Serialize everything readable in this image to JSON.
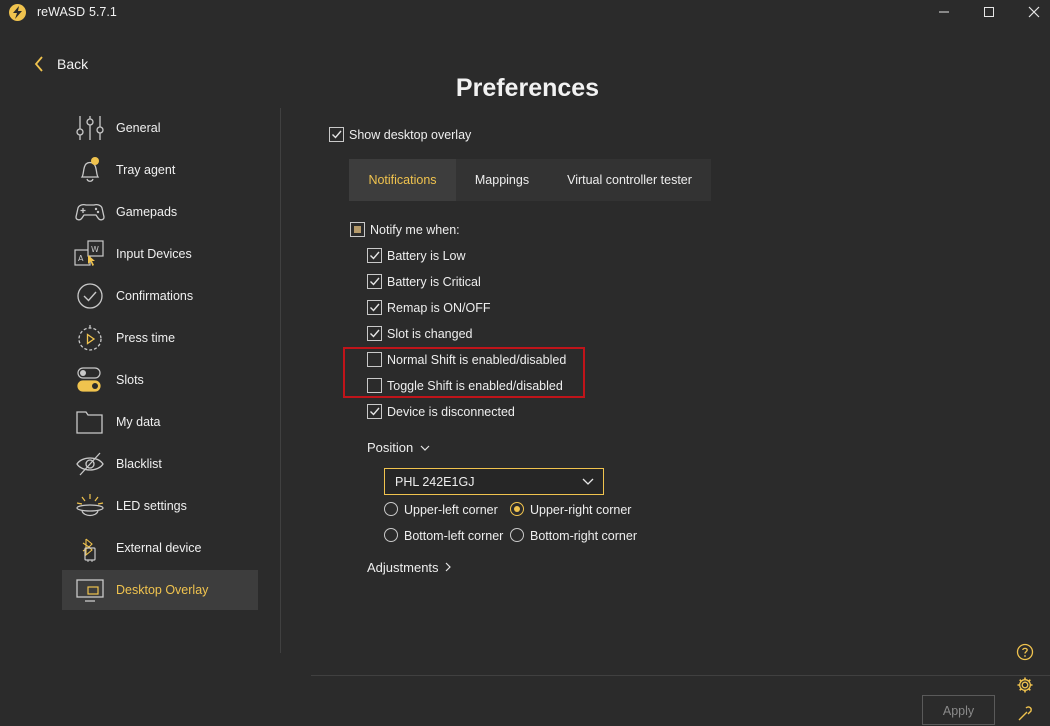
{
  "window": {
    "app_name": "reWASD",
    "version": "5.7.1"
  },
  "back_label": "Back",
  "page_title": "Preferences",
  "sidebar": {
    "items": [
      {
        "label": "General",
        "icon": "sliders-icon"
      },
      {
        "label": "Tray agent",
        "icon": "bell-icon"
      },
      {
        "label": "Gamepads",
        "icon": "gamepad-icon"
      },
      {
        "label": "Input Devices",
        "icon": "input-devices-icon"
      },
      {
        "label": "Confirmations",
        "icon": "check-circle-icon"
      },
      {
        "label": "Press time",
        "icon": "stopwatch-icon"
      },
      {
        "label": "Slots",
        "icon": "toggles-icon"
      },
      {
        "label": "My data",
        "icon": "folder-icon"
      },
      {
        "label": "Blacklist",
        "icon": "eye-off-icon"
      },
      {
        "label": "LED settings",
        "icon": "led-icon"
      },
      {
        "label": "External device",
        "icon": "bluetooth-usb-icon"
      },
      {
        "label": "Desktop Overlay",
        "icon": "monitor-icon",
        "active": true
      }
    ]
  },
  "show_overlay": {
    "label": "Show desktop overlay",
    "checked": true
  },
  "tabs": [
    {
      "label": "Notifications",
      "active": true
    },
    {
      "label": "Mappings",
      "active": false
    },
    {
      "label": "Virtual controller tester",
      "active": false
    }
  ],
  "notify": {
    "label": "Notify me when:",
    "state": "partial",
    "options": [
      {
        "label": "Battery is Low",
        "checked": true
      },
      {
        "label": "Battery is Critical",
        "checked": true
      },
      {
        "label": "Remap is ON/OFF",
        "checked": true
      },
      {
        "label": "Slot is changed",
        "checked": true
      },
      {
        "label": "Normal Shift is enabled/disabled",
        "checked": false
      },
      {
        "label": "Toggle Shift is enabled/disabled",
        "checked": false
      },
      {
        "label": "Device is disconnected",
        "checked": true
      }
    ]
  },
  "position": {
    "label": "Position",
    "monitor": "PHL 242E1GJ",
    "corners": [
      {
        "label": "Upper-left corner",
        "selected": false
      },
      {
        "label": "Upper-right corner",
        "selected": true
      },
      {
        "label": "Bottom-left corner",
        "selected": false
      },
      {
        "label": "Bottom-right corner",
        "selected": false
      }
    ]
  },
  "adjustments_label": "Adjustments",
  "apply_label": "Apply",
  "colors": {
    "accent": "#f0c34e",
    "background": "#2b2b2b",
    "highlight": "#c0141a"
  }
}
